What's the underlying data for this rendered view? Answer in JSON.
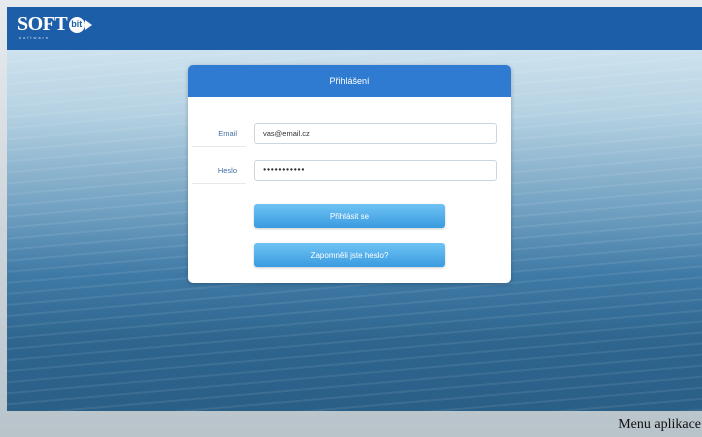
{
  "header": {
    "logo_text": "SOFT",
    "logo_badge": "bit",
    "logo_sub": "software"
  },
  "login": {
    "title": "Přihlášení",
    "email_label": "Email",
    "email_value": "vas@email.cz",
    "password_label": "Heslo",
    "password_value": "●●●●●●●●●●●",
    "login_button": "Přihlásit se",
    "forgot_button": "Zapomněli jste heslo?"
  },
  "caption": "Menu aplikace",
  "colors": {
    "topbar": "#1c5fa8",
    "card_header": "#2f7bd1",
    "button": "#3a9be0"
  }
}
